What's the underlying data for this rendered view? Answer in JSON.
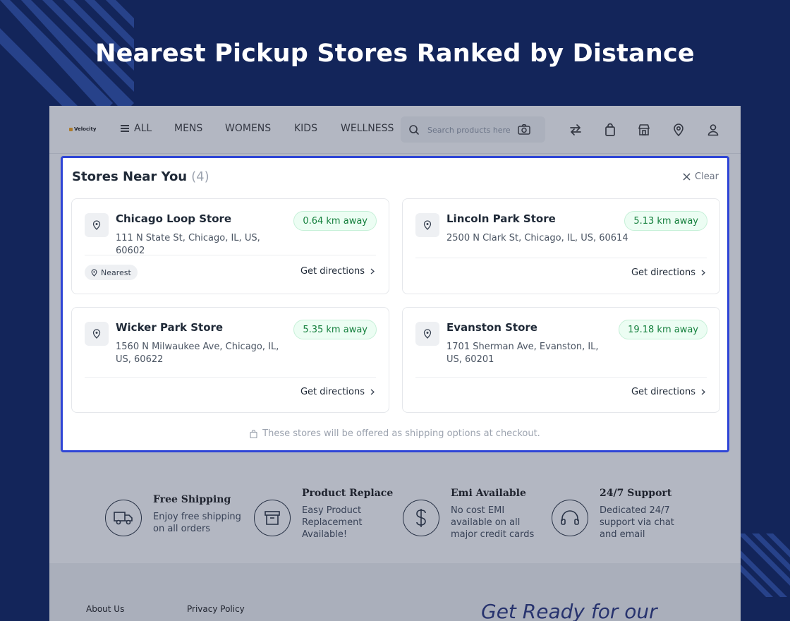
{
  "hero": {
    "title": "Nearest Pickup Stores Ranked by Distance"
  },
  "navbar": {
    "logo": "Velocity",
    "items": [
      "ALL",
      "MENS",
      "WOMENS",
      "KIDS",
      "WELLNESS"
    ],
    "search_placeholder": "Search products here",
    "icons": [
      "swap-icon",
      "bag-icon",
      "store-icon",
      "location-icon",
      "user-icon"
    ]
  },
  "modal": {
    "title": "Stores Near You",
    "count": "(4)",
    "clear_label": "Clear",
    "directions_label": "Get directions",
    "nearest_label": "Nearest",
    "note": "These stores will be offered as shipping options at checkout.",
    "stores": [
      {
        "name": "Chicago Loop Store",
        "address": "111 N State St, Chicago, IL, US, 60602",
        "distance": "0.64 km away"
      },
      {
        "name": "Lincoln Park Store",
        "address": "2500 N Clark St, Chicago, IL, US, 60614",
        "distance": "5.13 km away"
      },
      {
        "name": "Wicker Park Store",
        "address": "1560 N Milwaukee Ave, Chicago, IL, US, 60622",
        "distance": "5.35 km away"
      },
      {
        "name": "Evanston Store",
        "address": "1701 Sherman Ave, Evanston, IL, US, 60201",
        "distance": "19.18 km away"
      }
    ]
  },
  "features": [
    {
      "title": "Free Shipping",
      "desc": "Enjoy free shipping on all orders"
    },
    {
      "title": "Product Replace",
      "desc": "Easy Product Replacement Available!"
    },
    {
      "title": "Emi Available",
      "desc": "No cost EMI available on all major credit cards"
    },
    {
      "title": "24/7 Support",
      "desc": "Dedicated 24/7 support via chat and email"
    }
  ],
  "footer": {
    "links": [
      "About Us",
      "Privacy Policy"
    ],
    "promo": "Get Ready for our"
  },
  "colors": {
    "background": "#13255a",
    "modal_border": "#2f46d6",
    "distance_text": "#15803d",
    "distance_bg": "#ecfdf3"
  }
}
